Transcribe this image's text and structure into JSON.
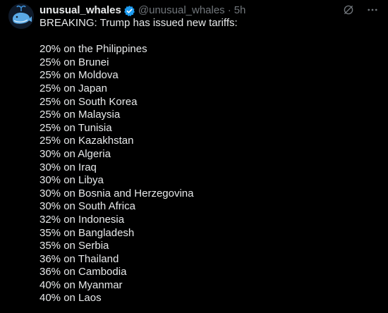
{
  "colors": {
    "background": "#000000",
    "text_primary": "#e7e9ea",
    "text_secondary": "#71767b",
    "verified_badge": "#1d9bf0"
  },
  "author": {
    "avatar_icon": "whale-avatar-icon",
    "display_name": "unusual_whales",
    "verified_icon": "verified-badge-icon",
    "handle": "@unusual_whales",
    "separator": "·",
    "timestamp": "5h"
  },
  "actions": {
    "grok_icon": "grok-icon",
    "more_icon": "more-icon"
  },
  "post": {
    "headline": "BREAKING: Trump has issued new tariffs:",
    "tariffs": [
      "20% on the Philippines",
      "25% on Brunei",
      "25% on Moldova",
      "25% on Japan",
      "25% on South Korea",
      "25% on Malaysia",
      "25% on Tunisia",
      "25% on Kazakhstan",
      "30% on Algeria",
      "30% on Iraq",
      "30% on Libya",
      "30% on Bosnia and Herzegovina",
      "30% on South Africa",
      "32% on Indonesia",
      "35% on Bangladesh",
      "35% on Serbia",
      "36% on Thailand",
      "36% on Cambodia",
      "40% on Myanmar",
      "40% on Laos"
    ]
  }
}
